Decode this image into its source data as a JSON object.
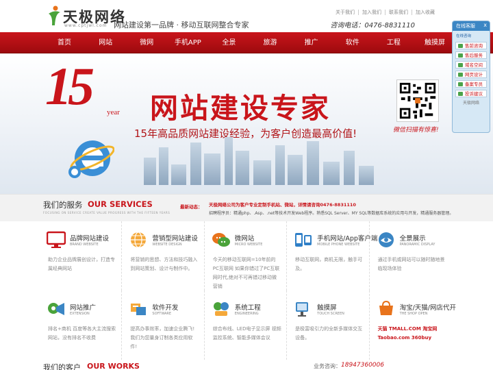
{
  "header": {
    "logo_text": "天极网络",
    "logo_sub": "www.cptjwl.com",
    "tagline": "网站建设第一品牌 · 移动互联网整合专家",
    "top_links": [
      "关于我们",
      "加入我们",
      "联系我们",
      "加入收藏"
    ],
    "phone": "咨询电话：0476-8831110"
  },
  "nav": [
    "首页",
    "网站",
    "微网",
    "手机APP",
    "全景",
    "旅游",
    "推广",
    "软件",
    "工程",
    "触摸屏"
  ],
  "banner": {
    "big_number": "15",
    "year": "year",
    "title": "网站建设专家",
    "subtitle": "15年高品质网站建设经验，为客户创造最高价值!",
    "qr_caption": "微信扫描有惊喜!"
  },
  "services": {
    "title_cn": "我们的服务",
    "title_en": "OUR SERVICES",
    "tiny": "FOCUSING ON SERVICE CREATE VALUE PROGRESS WITH THE FIFTEEN YEARS",
    "news_label": "最新动态：",
    "news_headline": "天极网络公司为客户专业定制手机站、微站，详情请咨询0476-8831110",
    "news_text": "招聘程序员：精通php、.Asp、.net等技术开发Web程序。熟悉SQL Server、MY SQL等数据库系统的应用与开发，精通服务器管理。"
  },
  "grid": {
    "row1": [
      {
        "title": "品牌网站建设",
        "en": "BRAND WEBSITE",
        "desc": "助力企业品牌展创设计，打造专属经典网站",
        "icon": "monitor-icon"
      },
      {
        "title": "营销型网站建设",
        "en": "WEBSITE DESIGN",
        "desc": "将营销的思想、方法和技巧融入到网站策划、设计与制作中。",
        "icon": "globe-icon"
      },
      {
        "title": "微网站",
        "en": "MICRO WEBSITE",
        "desc": "今天的移动互联网=10年前的PC互联网 如果你错过了PC互联网时代,绝对不可再错过移动微营销",
        "icon": "chat-icon"
      },
      {
        "title": "手机网站/App客户端",
        "en": "MOBILE PHONE WEBSITE",
        "desc": "移动互联网，商机无限，触手可及。",
        "icon": "phone-icon"
      },
      {
        "title": "全景展示",
        "en": "PANORAMIC DISPLAY",
        "desc": "通过手机或网站可以随时随地景临现场体验",
        "icon": "panorama-icon"
      }
    ],
    "row2": [
      {
        "title": "网站推广",
        "en": "EXTENSION",
        "desc": "排名+商机 百度等各大主流搜索网站，没有排名不收费",
        "icon": "megaphone-icon"
      },
      {
        "title": "软件开发",
        "en": "SOFTWARE",
        "desc": "提高办事效率，加速企业腾飞!我们为您量身订制各类应用软件!",
        "icon": "software-icon"
      },
      {
        "title": "系统工程",
        "en": "ENGINEERING",
        "desc": "综合布线、LED电子显示屏 视频监控系统、智能多媒体会议",
        "icon": "system-icon"
      },
      {
        "title": "触摸屏",
        "en": "TOUCH SCREEN",
        "desc": "是极富吸引力的全新多媒体交互设备。",
        "icon": "touch-icon"
      },
      {
        "title": "淘宝/天猫/网店代开",
        "en": "THE SHOP OPEN",
        "desc": "天猫 TMALL.COM 淘宝网 Taobao.com 360buy",
        "icon": "shop-icon"
      }
    ]
  },
  "bottom": {
    "work_cn": "我们的客户",
    "work_en": "OUR WORKS",
    "biz_label": "业务咨询：",
    "biz_phone": "18947360006"
  },
  "cs": {
    "head": "在线客服",
    "close": "x",
    "sub": "在线咨询",
    "items": [
      "售前咨询",
      "售后服务",
      "域名空间",
      "网页设计",
      "备案专员",
      "投诉建议"
    ],
    "foot": "天极网络"
  }
}
